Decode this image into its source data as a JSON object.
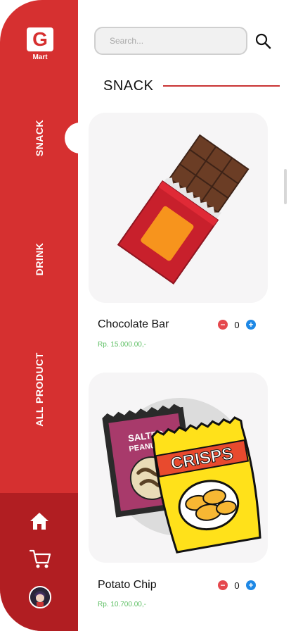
{
  "brand": {
    "letter": "G",
    "name": "Mart"
  },
  "sidebar": {
    "categories": [
      {
        "label": "SNACK"
      },
      {
        "label": "DRINK"
      },
      {
        "label": "ALL PRODUCT"
      }
    ],
    "active": "SNACK"
  },
  "search": {
    "placeholder": "Search...",
    "value": ""
  },
  "section": {
    "title": "SNACK"
  },
  "products": [
    {
      "name": "Chocolate Bar",
      "price": "Rp. 15.000.00,-",
      "quantity": "0",
      "image_icon": "chocolate-bar-illustration"
    },
    {
      "name": "Potato Chip",
      "price": "Rp. 10.700.00,-",
      "quantity": "0",
      "image_icon": "crisps-and-peanuts-illustration",
      "package_labels": {
        "peanuts_line1": "SALTED",
        "peanuts_line2": "PEANUTS",
        "crisps": "CRISPS"
      }
    }
  ],
  "nav": [
    "home-icon",
    "cart-icon",
    "avatar"
  ],
  "colors": {
    "primary": "#d63030",
    "primary_dark": "#b11e22",
    "price": "#5fc065",
    "minus": "#e5484d",
    "plus": "#1e88e5"
  }
}
